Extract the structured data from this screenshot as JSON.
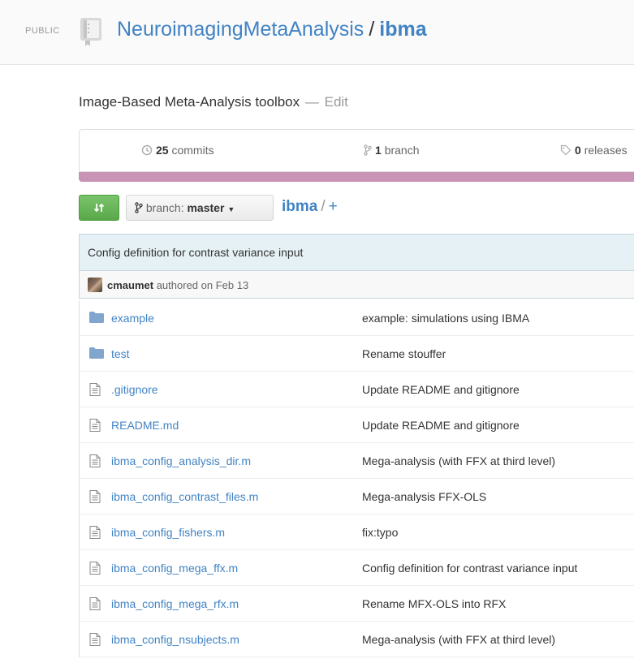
{
  "header": {
    "visibility": "PUBLIC",
    "owner": "NeuroimagingMetaAnalysis",
    "separator": "/",
    "repo": "ibma"
  },
  "description": {
    "text": "Image-Based Meta-Analysis toolbox",
    "dash": "—",
    "edit": "Edit"
  },
  "summary": {
    "commits_count": "25",
    "commits_label": "commits",
    "branches_count": "1",
    "branches_label": "branch",
    "releases_count": "0",
    "releases_label": "releases",
    "language_bar_color": "#c893b4"
  },
  "nav": {
    "branch_label": "branch:",
    "branch_value": "master",
    "breadcrumb_root": "ibma",
    "breadcrumb_sep": "/",
    "breadcrumb_add": "+"
  },
  "latest_commit": {
    "message": "Config definition for contrast variance input",
    "author": "cmaumet",
    "authored_text": "authored on Feb 13"
  },
  "files": [
    {
      "name": "example",
      "type": "folder",
      "message": "example: simulations using IBMA"
    },
    {
      "name": "test",
      "type": "folder",
      "message": "Rename stouffer"
    },
    {
      "name": ".gitignore",
      "type": "file",
      "message": "Update README and gitignore"
    },
    {
      "name": "README.md",
      "type": "file",
      "message": "Update README and gitignore"
    },
    {
      "name": "ibma_config_analysis_dir.m",
      "type": "file",
      "message": "Mega-analysis (with FFX at third level)"
    },
    {
      "name": "ibma_config_contrast_files.m",
      "type": "file",
      "message": "Mega-analysis FFX-OLS"
    },
    {
      "name": "ibma_config_fishers.m",
      "type": "file",
      "message": "fix:typo"
    },
    {
      "name": "ibma_config_mega_ffx.m",
      "type": "file",
      "message": "Config definition for contrast variance input"
    },
    {
      "name": "ibma_config_mega_rfx.m",
      "type": "file",
      "message": "Rename MFX-OLS into RFX"
    },
    {
      "name": "ibma_config_nsubjects.m",
      "type": "file",
      "message": "Mega-analysis (with FFX at third level)"
    }
  ],
  "colors": {
    "link": "#4183c4",
    "compare_button": "#6cc644",
    "folder_icon": "#80a6cd"
  }
}
